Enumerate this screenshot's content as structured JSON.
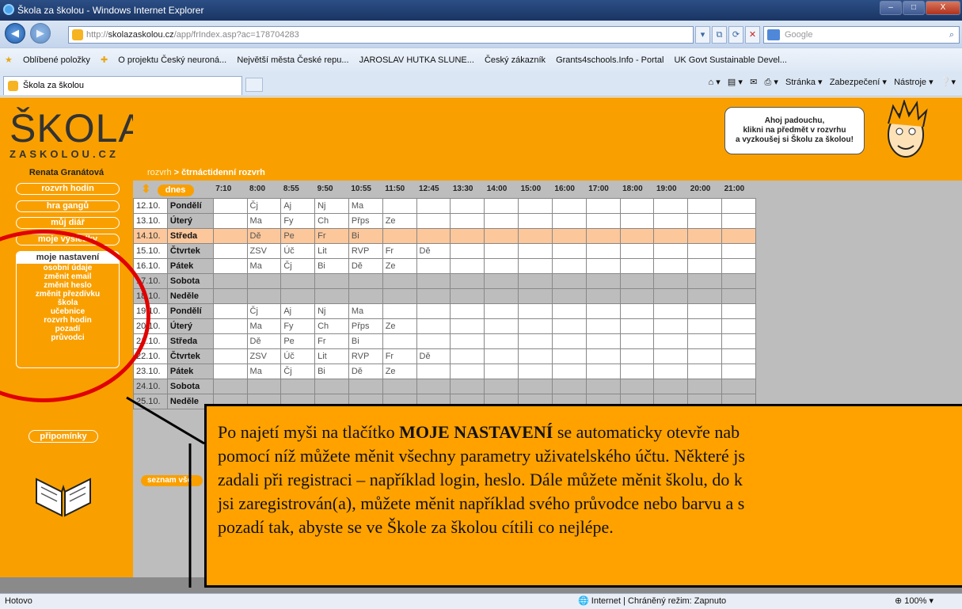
{
  "window": {
    "title": "Škola za školou - Windows Internet Explorer",
    "min": "–",
    "max": "□",
    "close": "X"
  },
  "address": {
    "url_prefix": "http://",
    "url_host": "skolazaskolou.cz",
    "url_path": "/app/frIndex.asp?ac=178704283",
    "search_placeholder": "Google"
  },
  "favorites": {
    "label": "Oblíbené položky",
    "items": [
      "O projektu Český neuroná...",
      "Největší města České repu...",
      "JAROSLAV HUTKA SLUNE...",
      "Český zákazník",
      "Grants4schools.Info - Portal",
      "UK Govt Sustainable Devel..."
    ]
  },
  "tab": {
    "label": "Škola za školou"
  },
  "commandbar": {
    "stranka": "Stránka ▾",
    "zabezpeceni": "Zabezpečení ▾",
    "nastroje": "Nástroje ▾"
  },
  "logo": {
    "main": "ŠKOLA",
    "sub": "ZASKOLOU.CZ"
  },
  "bubble": {
    "line1": "Ahoj padouchu,",
    "line2": "klikni na předmět v rozvrhu",
    "line3": "a vyzkoušej si Školu za školou!"
  },
  "user": {
    "name": "Renata Granátová"
  },
  "breadcrumb": {
    "link": "rozvrh",
    "sep": " > ",
    "current": "čtrnáctidenní rozvrh"
  },
  "leftmenu": {
    "rozvrh": "rozvrh hodin",
    "hra": "hra gangů",
    "diar": "můj diář",
    "vysledky": "moje výsledky",
    "nastaveni": "moje nastavení",
    "items": [
      "osobní údaje",
      "změnit email",
      "změnit heslo",
      "změnit přezdívku",
      "škola",
      "učebnice",
      "rozvrh hodin",
      "pozadí",
      "průvodci"
    ],
    "pripominky": "připomínky"
  },
  "schedule": {
    "dnes": "dnes",
    "times": [
      "7:10",
      "8:00",
      "8:55",
      "9:50",
      "10:55",
      "11:50",
      "12:45",
      "13:30",
      "14:00",
      "15:00",
      "16:00",
      "17:00",
      "18:00",
      "19:00",
      "20:00",
      "21:00"
    ],
    "rows": [
      {
        "date": "12.10.",
        "day": "Pondělí",
        "cells": [
          "",
          "Čj",
          "Aj",
          "Nj",
          "Ma",
          "",
          "",
          "",
          "",
          "",
          "",
          "",
          "",
          "",
          "",
          ""
        ]
      },
      {
        "date": "13.10.",
        "day": "Úterý",
        "cells": [
          "",
          "Ma",
          "Fy",
          "Ch",
          "Přps",
          "Ze",
          "",
          "",
          "",
          "",
          "",
          "",
          "",
          "",
          "",
          ""
        ]
      },
      {
        "date": "14.10.",
        "day": "Středa",
        "cells": [
          "",
          "Dě",
          "Pe",
          "Fr",
          "Bi",
          "",
          "",
          "",
          "",
          "",
          "",
          "",
          "",
          "",
          "",
          ""
        ]
      },
      {
        "date": "15.10.",
        "day": "Čtvrtek",
        "cells": [
          "",
          "ZSV",
          "Úč",
          "Lit",
          "RVP",
          "Fr",
          "Dě",
          "",
          "",
          "",
          "",
          "",
          "",
          "",
          "",
          ""
        ]
      },
      {
        "date": "16.10.",
        "day": "Pátek",
        "cells": [
          "",
          "Ma",
          "Čj",
          "Bi",
          "Dě",
          "Ze",
          "",
          "",
          "",
          "",
          "",
          "",
          "",
          "",
          "",
          ""
        ]
      },
      {
        "date": "17.10.",
        "day": "Sobota",
        "cells": [
          "",
          "",
          "",
          "",
          "",
          "",
          "",
          "",
          "",
          "",
          "",
          "",
          "",
          "",
          "",
          ""
        ]
      },
      {
        "date": "18.10.",
        "day": "Neděle",
        "cells": [
          "",
          "",
          "",
          "",
          "",
          "",
          "",
          "",
          "",
          "",
          "",
          "",
          "",
          "",
          "",
          ""
        ]
      },
      {
        "date": "19.10.",
        "day": "Pondělí",
        "cells": [
          "",
          "Čj",
          "Aj",
          "Nj",
          "Ma",
          "",
          "",
          "",
          "",
          "",
          "",
          "",
          "",
          "",
          "",
          ""
        ]
      },
      {
        "date": "20.10.",
        "day": "Úterý",
        "cells": [
          "",
          "Ma",
          "Fy",
          "Ch",
          "Přps",
          "Ze",
          "",
          "",
          "",
          "",
          "",
          "",
          "",
          "",
          "",
          ""
        ]
      },
      {
        "date": "21.10.",
        "day": "Středa",
        "cells": [
          "",
          "Dě",
          "Pe",
          "Fr",
          "Bi",
          "",
          "",
          "",
          "",
          "",
          "",
          "",
          "",
          "",
          "",
          ""
        ]
      },
      {
        "date": "22.10.",
        "day": "Čtvrtek",
        "cells": [
          "",
          "ZSV",
          "Úč",
          "Lit",
          "RVP",
          "Fr",
          "Dě",
          "",
          "",
          "",
          "",
          "",
          "",
          "",
          "",
          ""
        ]
      },
      {
        "date": "23.10.",
        "day": "Pátek",
        "cells": [
          "",
          "Ma",
          "Čj",
          "Bi",
          "Dě",
          "Ze",
          "",
          "",
          "",
          "",
          "",
          "",
          "",
          "",
          "",
          ""
        ]
      },
      {
        "date": "24.10.",
        "day": "Sobota",
        "cells": [
          "",
          "",
          "",
          "",
          "",
          "",
          "",
          "",
          "",
          "",
          "",
          "",
          "",
          "",
          "",
          ""
        ]
      },
      {
        "date": "25.10.",
        "day": "Neděle",
        "cells": [
          "",
          "",
          "",
          "",
          "",
          "",
          "",
          "",
          "",
          "",
          "",
          "",
          "",
          "",
          "",
          ""
        ]
      }
    ],
    "seznam": "seznam vše"
  },
  "callout": {
    "line1_pre": "Po najetí myši na tlačítko ",
    "line1_bold": "MOJE NASTAVENÍ",
    "line1_post": " se automaticky otevře nab",
    "line2": "pomocí níž můžete měnit všechny parametry uživatelského účtu. Některé js",
    "line3": "zadali při registraci – například login, heslo. Dále můžete měnit školu, do k",
    "line4": "jsi zaregistrován(a), můžete měnit například svého průvodce nebo barvu a s",
    "line5": "pozadí tak, abyste se ve Škole za školou cítili co nejlépe."
  },
  "status": {
    "left": "Hotovo",
    "zone": "Internet | Chráněný režim: Zapnuto",
    "zoom": "100%"
  }
}
